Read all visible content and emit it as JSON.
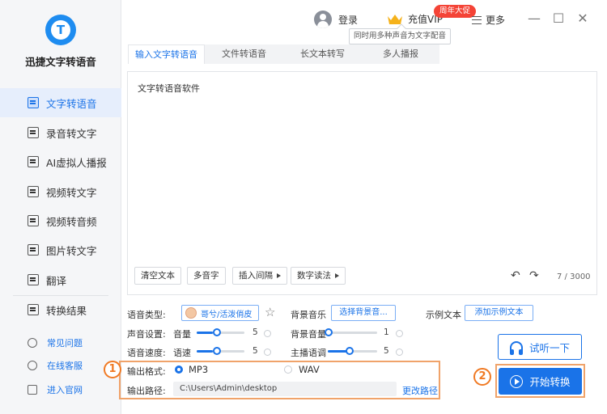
{
  "app": {
    "name": "迅捷文字转语音",
    "accent": "#1a73e8",
    "highlight": "#f07a24"
  },
  "sidebar": {
    "items": [
      {
        "label": "文字转语音",
        "icon": "text-to-speech-icon",
        "active": true
      },
      {
        "label": "录音转文字",
        "icon": "recording-icon"
      },
      {
        "label": "AI虚拟人播报",
        "icon": "ai-avatar-icon"
      },
      {
        "label": "视频转文字",
        "icon": "video-text-icon"
      },
      {
        "label": "视频转音频",
        "icon": "video-audio-icon"
      },
      {
        "label": "图片转文字",
        "icon": "image-text-icon"
      },
      {
        "label": "翻译",
        "icon": "translate-icon"
      },
      {
        "label": "转换结果",
        "icon": "result-icon"
      }
    ],
    "bottom": [
      {
        "label": "常见问题",
        "icon": "help-icon"
      },
      {
        "label": "在线客服",
        "icon": "headset-icon"
      },
      {
        "label": "进入官网",
        "icon": "monitor-icon"
      }
    ]
  },
  "topbar": {
    "login": "登录",
    "vip": "充值VIP",
    "vip_badge": "周年大促",
    "vip_tooltip": "同时用多种声音为文字配音",
    "more": "更多"
  },
  "tabs": [
    "输入文字转语音",
    "文件转语音",
    "长文本转写",
    "多人播报"
  ],
  "editor": {
    "text": "文字转语音软件",
    "buttons": [
      "清空文本",
      "多音字",
      "插入间隔",
      "数字读法"
    ],
    "counter": "7 / 3000"
  },
  "settings": {
    "voice_type_label": "语音类型:",
    "voice_name": "哥兮/活泼俏皮",
    "bg_music_label": "背景音乐",
    "bg_music_btn": "选择背景音...",
    "example_label": "示例文本",
    "example_btn": "添加示例文本",
    "voice_settings_label": "声音设置:",
    "volume_label": "音量",
    "volume_value": "5",
    "bg_volume_label": "背景音量",
    "bg_volume_value": "1",
    "speed_settings_label": "语音速度:",
    "speed_label": "语速",
    "speed_value": "5",
    "pitch_label": "主播语调",
    "pitch_value": "5",
    "volume_level": 0.34,
    "bg_volume_level": 0.0,
    "speed_level": 0.34,
    "pitch_level": 0.4
  },
  "output": {
    "format_label": "输出格式:",
    "format_mp3": "MP3",
    "format_wav": "WAV",
    "path_label": "输出路径:",
    "path_value": "C:\\Users\\Admin\\desktop",
    "change_path": "更改路径"
  },
  "actions": {
    "listen": "试听一下",
    "start": "开始转换",
    "marker1": "1",
    "marker2": "2"
  }
}
